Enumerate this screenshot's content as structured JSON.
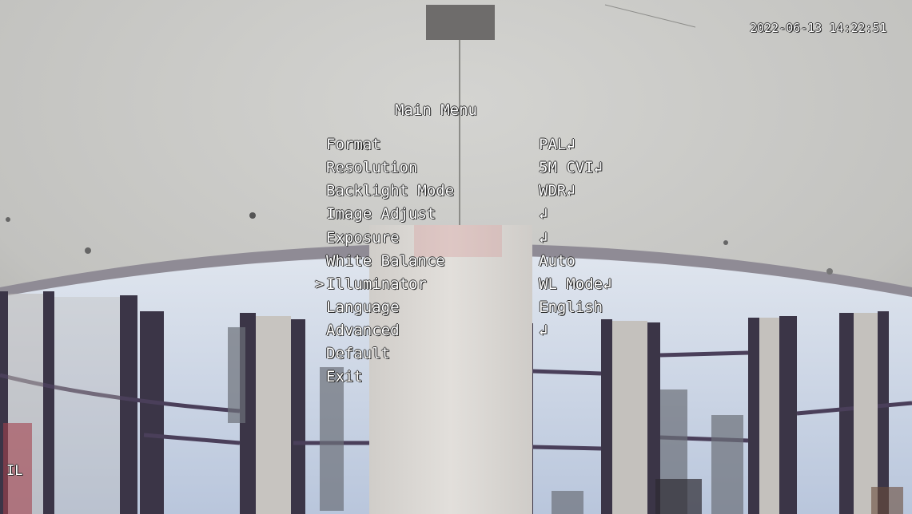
{
  "osd": {
    "timestamp": "2022-06-13 14:22:51",
    "title": "Main Menu",
    "cursor": ">",
    "corner_text": "IL",
    "items": [
      {
        "label": "Format",
        "value": "PAL↲"
      },
      {
        "label": "Resolution",
        "value": "5M CVI↲"
      },
      {
        "label": "Backlight Mode",
        "value": "WDR↲"
      },
      {
        "label": "Image Adjust",
        "value": "↲"
      },
      {
        "label": "Exposure",
        "value": "↲"
      },
      {
        "label": "White Balance",
        "value": "Auto"
      },
      {
        "label": "Illuminator",
        "value": "WL Mode↲",
        "selected": true
      },
      {
        "label": "Language",
        "value": "English"
      },
      {
        "label": "Advanced",
        "value": "↲"
      },
      {
        "label": "Default",
        "value": ""
      },
      {
        "label": "Exit",
        "value": ""
      }
    ]
  },
  "colors": {
    "osd_text": "#ffffff",
    "ceiling": "#c9c9c6",
    "sky": "#b9c6dc",
    "window_frame": "#3b3547",
    "pillar": "#d9d6d2"
  }
}
